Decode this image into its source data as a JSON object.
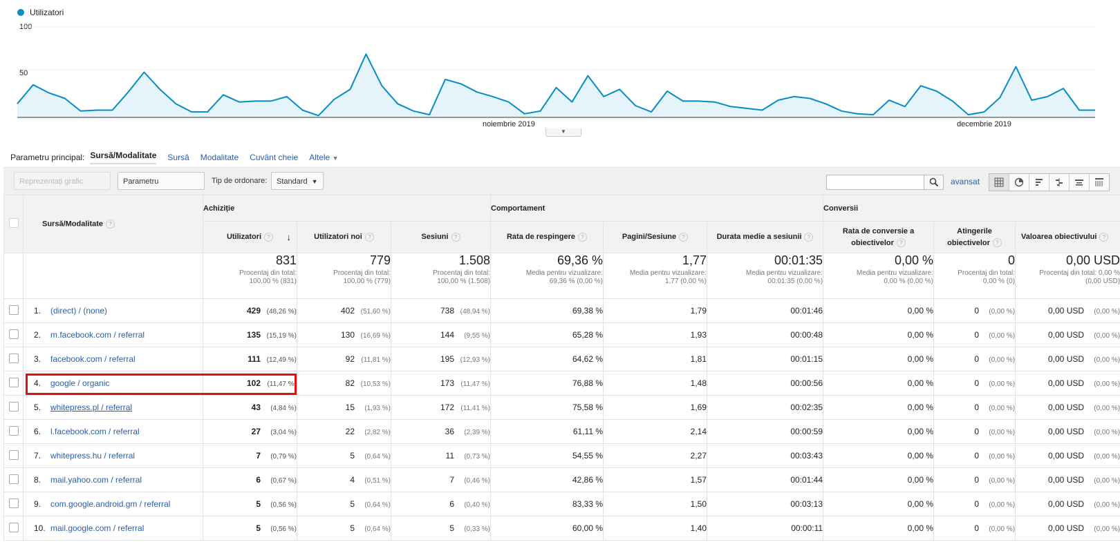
{
  "chart": {
    "legend_label": "Utilizatori",
    "y_ticks": [
      "100",
      "50"
    ],
    "x_labels": [
      "noiembrie 2019",
      "decembrie 2019"
    ],
    "series_color": "#058dc7"
  },
  "chart_data": {
    "type": "area",
    "title": "",
    "ylabel": "",
    "xlabel": "",
    "ylim": [
      0,
      100
    ],
    "series": [
      {
        "name": "Utilizatori",
        "values": [
          15,
          36,
          27,
          21,
          7,
          8,
          8,
          28,
          50,
          31,
          15,
          6,
          6,
          25,
          17,
          18,
          18,
          23,
          8,
          2,
          20,
          31,
          70,
          35,
          15,
          7,
          3,
          42,
          37,
          28,
          23,
          17,
          4,
          7,
          33,
          17,
          46,
          23,
          31,
          13,
          6,
          29,
          18,
          18,
          17,
          12,
          10,
          8,
          19,
          23,
          21,
          15,
          7,
          4,
          3,
          19,
          12,
          35,
          29,
          18,
          3,
          6,
          22,
          56,
          19,
          23,
          32,
          8,
          8
        ],
        "start_date": "2019-10-17",
        "interval": "day"
      }
    ]
  },
  "dimensions": {
    "label": "Parametru principal:",
    "active": "Sursă/Modalitate",
    "links": [
      "Sursă",
      "Modalitate",
      "Cuvânt cheie",
      "Altele"
    ]
  },
  "toolbar": {
    "plot_rows": "Reprezentați grafic rândurile",
    "secondary_dim": "Parametru secundar",
    "sort_label": "Tip de ordonare:",
    "sort_value": "Standard",
    "advanced": "avansat",
    "search_value": ""
  },
  "table": {
    "dim_header": "Sursă/Modalitate",
    "groups": [
      "Achiziție",
      "Comportament",
      "Conversii"
    ],
    "columns": [
      "Utilizatori",
      "Utilizatori noi",
      "Sesiuni",
      "Rata de respingere",
      "Pagini/Sesiune",
      "Durata medie a sesiunii",
      "Rata de conversie a obiectivelor",
      "Atingerile obiectivelor",
      "Valoarea obiectivului"
    ],
    "totals": [
      {
        "value": "831",
        "note1": "Procentaj din total:",
        "note2": "100,00 % (831)"
      },
      {
        "value": "779",
        "note1": "Procentaj din total:",
        "note2": "100,00 % (779)"
      },
      {
        "value": "1.508",
        "note1": "Procentaj din total:",
        "note2": "100,00 % (1.508)"
      },
      {
        "value": "69,36 %",
        "note1": "Media pentru vizualizare:",
        "note2": "69,36 % (0,00 %)"
      },
      {
        "value": "1,77",
        "note1": "Media pentru vizualizare:",
        "note2": "1,77 (0,00 %)"
      },
      {
        "value": "00:01:35",
        "note1": "Media pentru vizualizare:",
        "note2": "00:01:35 (0,00 %)"
      },
      {
        "value": "0,00 %",
        "note1": "Media pentru vizualizare:",
        "note2": "0,00 % (0,00 %)"
      },
      {
        "value": "0",
        "note1": "Procentaj din total:",
        "note2": "0,00 % (0)"
      },
      {
        "value": "0,00 USD",
        "note1": "Procentaj din total: 0,00 %",
        "note2": "(0,00 USD)"
      }
    ],
    "rows": [
      {
        "idx": "1.",
        "src": "(direct) / (none)",
        "users": "429",
        "users_pct": "(48,26 %)",
        "new": "402",
        "new_pct": "(51,60 %)",
        "sess": "738",
        "sess_pct": "(48,94 %)",
        "bounce": "69,38 %",
        "pages": "1,79",
        "dur": "00:01:46",
        "conv": "0,00 %",
        "goals": "0",
        "goals_pct": "(0,00 %)",
        "val": "0,00 USD",
        "val_pct": "(0,00 %)"
      },
      {
        "idx": "2.",
        "src": "m.facebook.com / referral",
        "users": "135",
        "users_pct": "(15,19 %)",
        "new": "130",
        "new_pct": "(16,69 %)",
        "sess": "144",
        "sess_pct": "(9,55 %)",
        "bounce": "65,28 %",
        "pages": "1,93",
        "dur": "00:00:48",
        "conv": "0,00 %",
        "goals": "0",
        "goals_pct": "(0,00 %)",
        "val": "0,00 USD",
        "val_pct": "(0,00 %)"
      },
      {
        "idx": "3.",
        "src": "facebook.com / referral",
        "users": "111",
        "users_pct": "(12,49 %)",
        "new": "92",
        "new_pct": "(11,81 %)",
        "sess": "195",
        "sess_pct": "(12,93 %)",
        "bounce": "64,62 %",
        "pages": "1,81",
        "dur": "00:01:15",
        "conv": "0,00 %",
        "goals": "0",
        "goals_pct": "(0,00 %)",
        "val": "0,00 USD",
        "val_pct": "(0,00 %)"
      },
      {
        "idx": "4.",
        "src": "google / organic",
        "users": "102",
        "users_pct": "(11,47 %)",
        "new": "82",
        "new_pct": "(10,53 %)",
        "sess": "173",
        "sess_pct": "(11,47 %)",
        "bounce": "76,88 %",
        "pages": "1,48",
        "dur": "00:00:56",
        "conv": "0,00 %",
        "goals": "0",
        "goals_pct": "(0,00 %)",
        "val": "0,00 USD",
        "val_pct": "(0,00 %)"
      },
      {
        "idx": "5.",
        "src": "whitepress.pl / referral",
        "users": "43",
        "users_pct": "(4,84 %)",
        "new": "15",
        "new_pct": "(1,93 %)",
        "sess": "172",
        "sess_pct": "(11,41 %)",
        "bounce": "75,58 %",
        "pages": "1,69",
        "dur": "00:02:35",
        "conv": "0,00 %",
        "goals": "0",
        "goals_pct": "(0,00 %)",
        "val": "0,00 USD",
        "val_pct": "(0,00 %)"
      },
      {
        "idx": "6.",
        "src": "l.facebook.com / referral",
        "users": "27",
        "users_pct": "(3,04 %)",
        "new": "22",
        "new_pct": "(2,82 %)",
        "sess": "36",
        "sess_pct": "(2,39 %)",
        "bounce": "61,11 %",
        "pages": "2,14",
        "dur": "00:00:59",
        "conv": "0,00 %",
        "goals": "0",
        "goals_pct": "(0,00 %)",
        "val": "0,00 USD",
        "val_pct": "(0,00 %)"
      },
      {
        "idx": "7.",
        "src": "whitepress.hu / referral",
        "users": "7",
        "users_pct": "(0,79 %)",
        "new": "5",
        "new_pct": "(0,64 %)",
        "sess": "11",
        "sess_pct": "(0,73 %)",
        "bounce": "54,55 %",
        "pages": "2,27",
        "dur": "00:03:43",
        "conv": "0,00 %",
        "goals": "0",
        "goals_pct": "(0,00 %)",
        "val": "0,00 USD",
        "val_pct": "(0,00 %)"
      },
      {
        "idx": "8.",
        "src": "mail.yahoo.com / referral",
        "users": "6",
        "users_pct": "(0,67 %)",
        "new": "4",
        "new_pct": "(0,51 %)",
        "sess": "7",
        "sess_pct": "(0,46 %)",
        "bounce": "42,86 %",
        "pages": "1,57",
        "dur": "00:01:44",
        "conv": "0,00 %",
        "goals": "0",
        "goals_pct": "(0,00 %)",
        "val": "0,00 USD",
        "val_pct": "(0,00 %)"
      },
      {
        "idx": "9.",
        "src": "com.google.android.gm / referral",
        "users": "5",
        "users_pct": "(0,56 %)",
        "new": "5",
        "new_pct": "(0,64 %)",
        "sess": "6",
        "sess_pct": "(0,40 %)",
        "bounce": "83,33 %",
        "pages": "1,50",
        "dur": "00:03:13",
        "conv": "0,00 %",
        "goals": "0",
        "goals_pct": "(0,00 %)",
        "val": "0,00 USD",
        "val_pct": "(0,00 %)"
      },
      {
        "idx": "10.",
        "src": "mail.google.com / referral",
        "users": "5",
        "users_pct": "(0,56 %)",
        "new": "5",
        "new_pct": "(0,64 %)",
        "sess": "5",
        "sess_pct": "(0,33 %)",
        "bounce": "60,00 %",
        "pages": "1,40",
        "dur": "00:00:11",
        "conv": "0,00 %",
        "goals": "0",
        "goals_pct": "(0,00 %)",
        "val": "0,00 USD",
        "val_pct": "(0,00 %)"
      }
    ]
  }
}
